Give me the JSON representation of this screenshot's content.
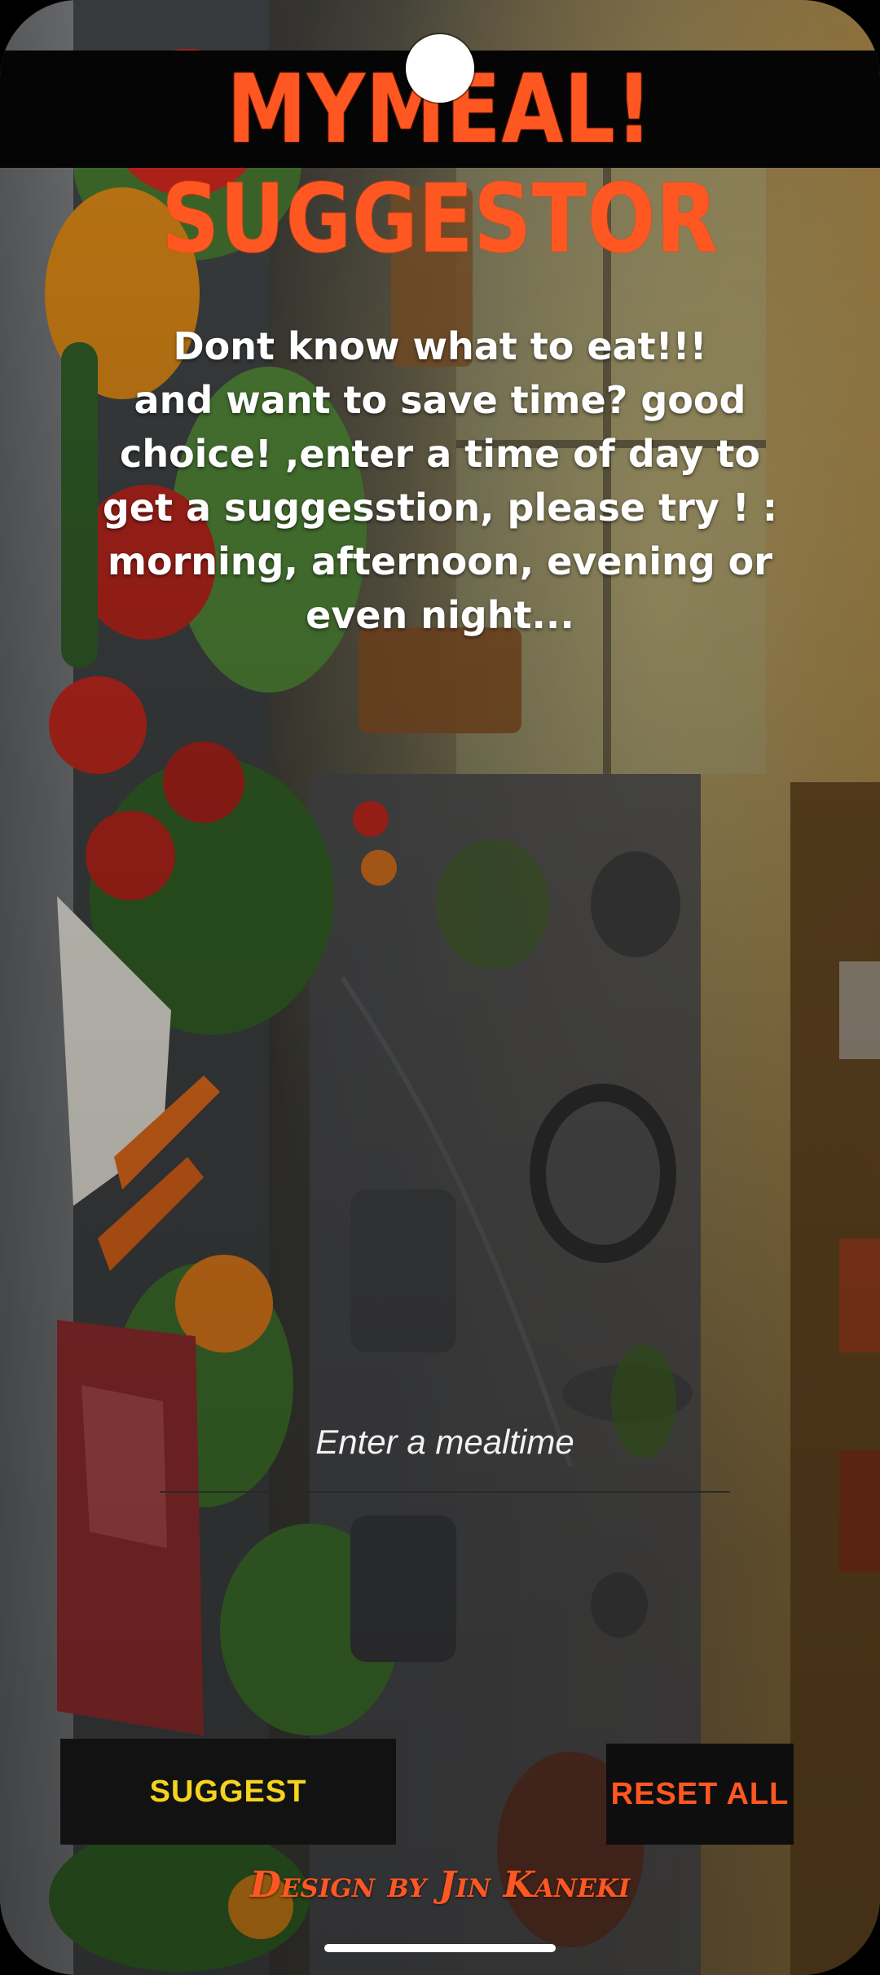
{
  "app": {
    "title": "MYMEAL! SUGGESTOR"
  },
  "intro": {
    "text": "Dont know what to eat!!!\nand want to save time? good choice! ,enter a time of day to get a suggesstion, please try ! : morning, afternoon, evening or even night..."
  },
  "mealtime_input": {
    "placeholder": "Enter a mealtime",
    "value": ""
  },
  "buttons": {
    "suggest_label": "SUGGEST",
    "reset_label": "RESET ALL"
  },
  "footer": {
    "credit": "Design by Jin Kaneki"
  },
  "colors": {
    "title": "#ff5722",
    "suggest_text": "#f5d31f",
    "reset_text": "#ff5722",
    "button_bg": "#121212",
    "titlebar_bg": "#050505"
  },
  "background": {
    "icon": "kitchen-vegetables-background"
  }
}
